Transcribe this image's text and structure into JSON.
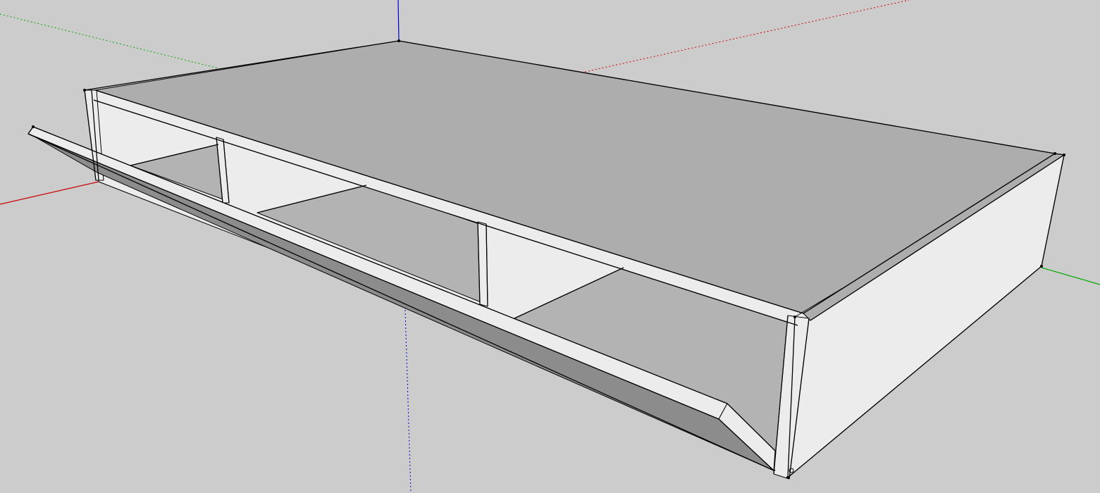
{
  "app": {
    "view": "3d-model-viewport",
    "background_color": "#cccccc"
  },
  "axes": {
    "red_axis_color": "#cc0000",
    "green_axis_color": "#00aa00",
    "blue_axis_color": "#0000cc"
  },
  "model": {
    "name": "open-drawer-cabinet",
    "top_panel_color": "#adadad",
    "interior_floor_color": "#b3b3b3",
    "panel_face_color": "#ececec",
    "drawer_front_shade_color": "#8c8c8c",
    "edge_color": "#000000",
    "divider_count": 2
  }
}
